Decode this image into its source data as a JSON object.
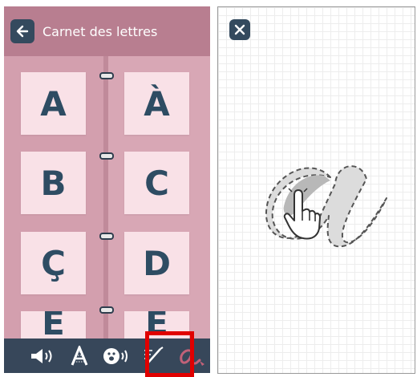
{
  "header": {
    "title": "Carnet des lettres",
    "back_icon": "arrow-left-icon"
  },
  "letters": [
    "A",
    "À",
    "B",
    "C",
    "Ç",
    "D",
    "E",
    "É"
  ],
  "toolbar": {
    "items": [
      "speaker-icon",
      "letters-pattern-icon",
      "face-sound-icon",
      "writing-strokes-icon",
      "cursive-a-icon"
    ],
    "selected": "cursive-a-icon"
  },
  "trace": {
    "letter": "a",
    "close_icon": "close-icon",
    "hand_icon": "pointing-hand-icon"
  },
  "colors": {
    "header": "#b87e90",
    "page": "#d39fae",
    "card": "#f9e1e7",
    "letter": "#2e4c63",
    "toolbar": "#37475a",
    "highlight": "#e00000",
    "button": "#344a5e"
  }
}
